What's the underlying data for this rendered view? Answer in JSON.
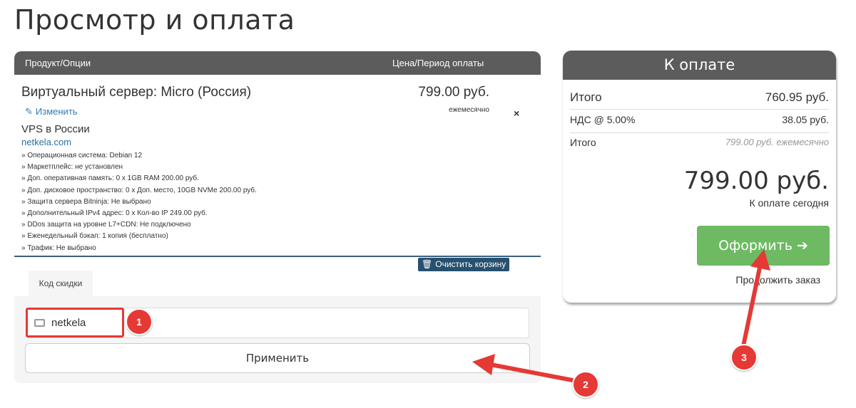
{
  "page": {
    "title": "Просмотр и оплата"
  },
  "cart": {
    "header_product": "Продукт/Опции",
    "header_price": "Цена/Период оплаты",
    "product_name": "Виртуальный сервер: Micro (Россия)",
    "edit_label": "Изменить",
    "group_name": "VPS в России",
    "domain": "netkela.com",
    "options": [
      "» Операционная система: Debian 12",
      "» Маркетплейс: не установлен",
      "» Доп. оперативная память: 0 x 1GB RAM 200.00 руб.",
      "» Доп. дисковое пространство: 0 x Доп. место, 10GB NVMe 200.00 руб.",
      "» Защита сервера Bitninja: Не выбрано",
      "» Дополнительный IPv4 адрес: 0 x Кол-во IP 249.00 руб.",
      "» DDos защита на уровне L7+CDN: Не подключено",
      "» Еженедельный бэкап: 1 копия (бесплатно)",
      "» Трафик: Не выбрано"
    ],
    "price": "799.00 руб.",
    "cycle": "ежемесячно",
    "remove_symbol": "×",
    "clear_label": "Очистить корзину"
  },
  "discount": {
    "tab_label": "Код скидки",
    "code_value": "netkela",
    "apply_label": "Применить"
  },
  "summary": {
    "title": "К оплате",
    "subtotal_label": "Итого",
    "subtotal_value": "760.95 руб.",
    "tax_label": "НДС @ 5.00%",
    "tax_value": "38.05 руб.",
    "recurring_label": "Итого",
    "recurring_value": "799.00 руб. ежемесячно",
    "total_due": "799.00 руб.",
    "total_due_label": "К оплате сегодня",
    "checkout_label": "Оформить",
    "continue_label": "Продолжить заказ"
  },
  "annotations": {
    "badge1": "1",
    "badge2": "2",
    "badge3": "3",
    "color": "#e53935"
  }
}
